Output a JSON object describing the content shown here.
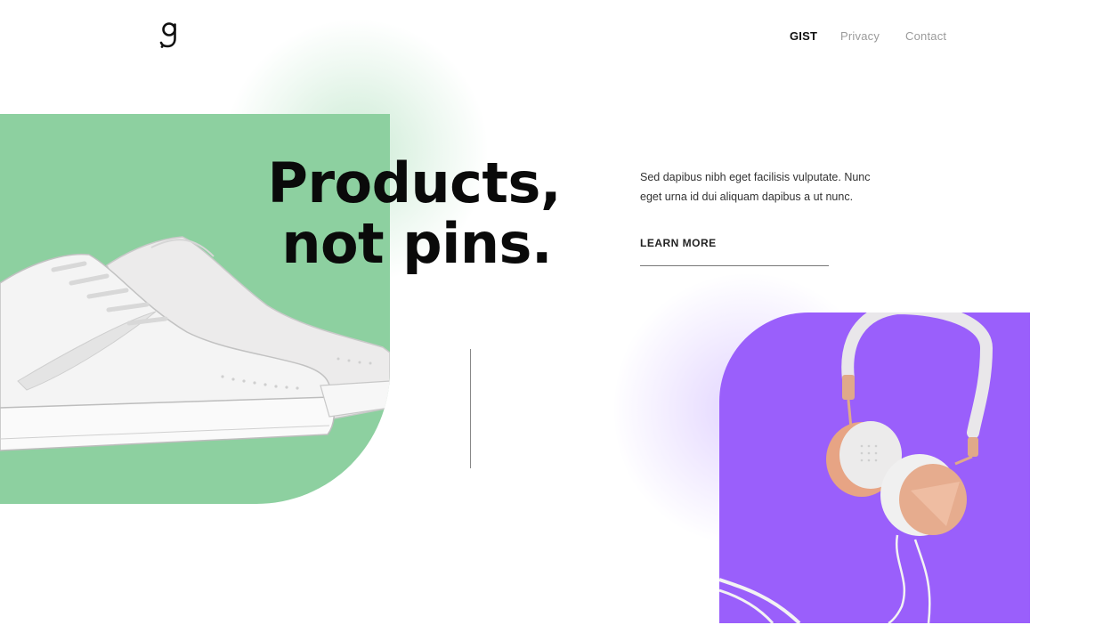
{
  "header": {
    "logo_glyph": "g",
    "nav": [
      {
        "label": "GIST",
        "active": true
      },
      {
        "label": "Privacy",
        "active": false
      },
      {
        "label": "Contact",
        "active": false
      }
    ]
  },
  "hero": {
    "headline_line1": "Products,",
    "headline_line2": "not pins.",
    "description": "Sed dapibus nibh eget facilisis vulputate. Nunc eget urna id dui aliquam dapibus a ut nunc.",
    "cta_label": "LEARN MORE"
  },
  "colors": {
    "green_card": "#8dd0a0",
    "purple_card": "#9a5ffb",
    "text": "#0a0a0a"
  },
  "images": {
    "green_card_image": "white-sneaker",
    "purple_card_image": "white-rose-gold-headphones"
  }
}
